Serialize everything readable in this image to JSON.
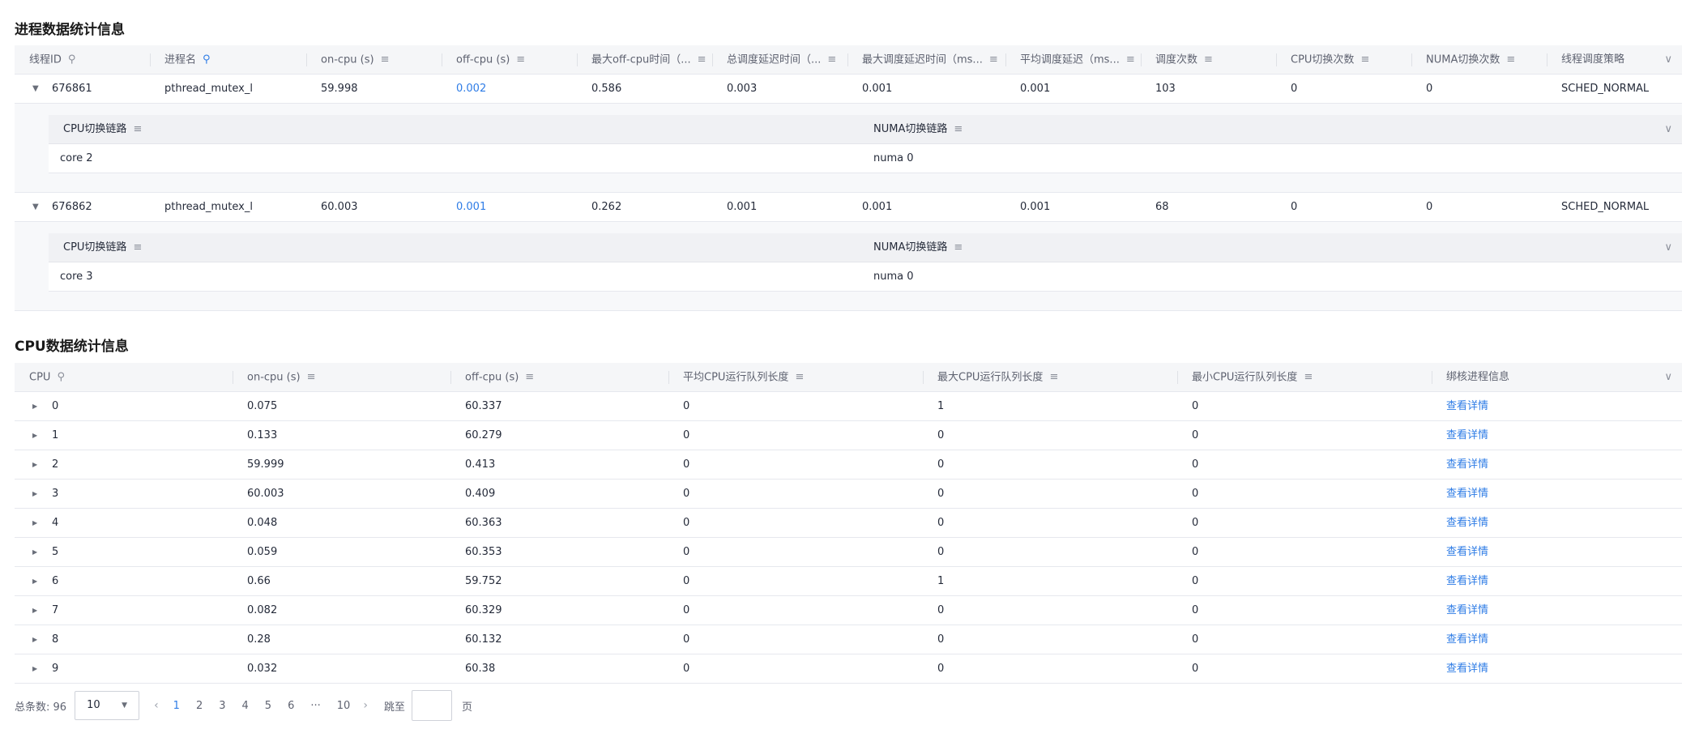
{
  "process_section": {
    "title": "进程数据统计信息",
    "headers": [
      "线程ID",
      "进程名",
      "on-cpu (s)",
      "off-cpu (s)",
      "最大off-cpu时间（...",
      "总调度延迟时间（...",
      "最大调度延迟时间（ms...",
      "平均调度延迟（ms...",
      "调度次数",
      "CPU切换次数",
      "NUMA切换次数",
      "线程调度策略"
    ],
    "rows": [
      {
        "cells": [
          "676861",
          "pthread_mutex_l",
          "59.998",
          "0.002",
          "0.586",
          "0.003",
          "0.001",
          "0.001",
          "103",
          "0",
          "0",
          "SCHED_NORMAL"
        ],
        "detail": {
          "cpu_header": "CPU切换链路",
          "numa_header": "NUMA切换链路",
          "cpu_value": "core 2",
          "numa_value": "numa 0"
        }
      },
      {
        "cells": [
          "676862",
          "pthread_mutex_l",
          "60.003",
          "0.001",
          "0.262",
          "0.001",
          "0.001",
          "0.001",
          "68",
          "0",
          "0",
          "SCHED_NORMAL"
        ],
        "detail": {
          "cpu_header": "CPU切换链路",
          "numa_header": "NUMA切换链路",
          "cpu_value": "core 3",
          "numa_value": "numa 0"
        }
      }
    ]
  },
  "cpu_section": {
    "title": "CPU数据统计信息",
    "headers": [
      "CPU",
      "on-cpu (s)",
      "off-cpu (s)",
      "平均CPU运行队列长度",
      "最大CPU运行队列长度",
      "最小CPU运行队列长度",
      "绑核进程信息"
    ],
    "rows": [
      [
        "0",
        "0.075",
        "60.337",
        "0",
        "1",
        "0",
        "查看详情"
      ],
      [
        "1",
        "0.133",
        "60.279",
        "0",
        "0",
        "0",
        "查看详情"
      ],
      [
        "2",
        "59.999",
        "0.413",
        "0",
        "0",
        "0",
        "查看详情"
      ],
      [
        "3",
        "60.003",
        "0.409",
        "0",
        "0",
        "0",
        "查看详情"
      ],
      [
        "4",
        "0.048",
        "60.363",
        "0",
        "0",
        "0",
        "查看详情"
      ],
      [
        "5",
        "0.059",
        "60.353",
        "0",
        "0",
        "0",
        "查看详情"
      ],
      [
        "6",
        "0.66",
        "59.752",
        "0",
        "1",
        "0",
        "查看详情"
      ],
      [
        "7",
        "0.082",
        "60.329",
        "0",
        "0",
        "0",
        "查看详情"
      ],
      [
        "8",
        "0.28",
        "60.132",
        "0",
        "0",
        "0",
        "查看详情"
      ],
      [
        "9",
        "0.032",
        "60.38",
        "0",
        "0",
        "0",
        "查看详情"
      ]
    ]
  },
  "pagination": {
    "total_label": "总条数: 96",
    "page_size": "10",
    "pages": [
      "1",
      "2",
      "3",
      "4",
      "5",
      "6",
      "···",
      "10"
    ],
    "active_page": "1",
    "jump_label": "跳至",
    "page_unit": "页"
  },
  "colors": {
    "link": "#2e7ce6",
    "header_bg": "#f5f6f8"
  }
}
